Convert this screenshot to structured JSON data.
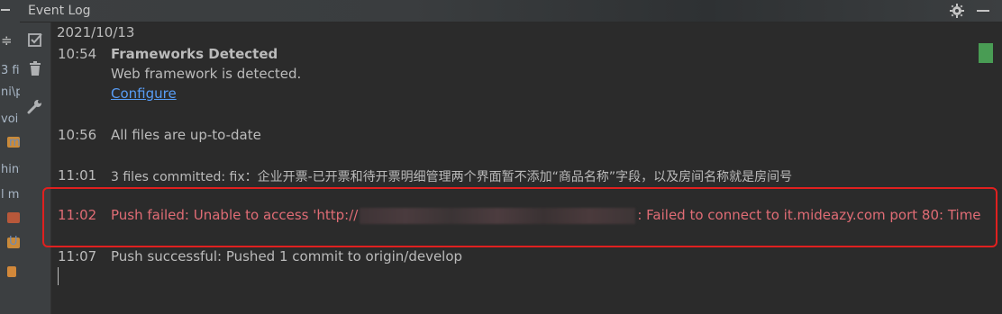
{
  "window": {
    "title": "Event Log"
  },
  "left_strip": {
    "lines": [
      "3 fi",
      "ni\\p",
      "voi",
      "m",
      "hiny",
      "l m",
      "",
      "U"
    ]
  },
  "log": {
    "date": "2021/10/13",
    "entries": [
      {
        "time": "10:54",
        "title": "Frameworks Detected",
        "message": "Web framework is detected.",
        "link": "Configure"
      },
      {
        "time": "10:56",
        "message": "All files are up-to-date"
      },
      {
        "time": "11:01",
        "message": "3 files committed: fix：企业开票-已开票和待开票明细管理两个界面暂不添加“商品名称”字段，以及房间名称就是房间号"
      },
      {
        "time": "11:02",
        "message_prefix": "Push failed: Unable to access 'http://",
        "message_suffix": ": Failed to connect to it.mideazy.com port 80: Time"
      },
      {
        "time": "11:07",
        "message": "Push successful: Pushed 1 commit to origin/develop"
      }
    ]
  },
  "colors": {
    "error": "#e06c75",
    "link": "#589df6",
    "highlight": "#e0201f",
    "marker": "#499c54"
  },
  "icons": [
    "gear-icon",
    "minimize-icon",
    "mark-read-icon",
    "trash-icon",
    "wrench-icon"
  ]
}
